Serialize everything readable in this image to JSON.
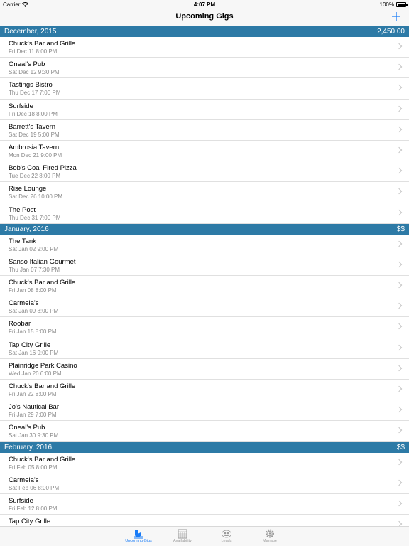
{
  "status": {
    "carrier": "Carrier",
    "time": "4:07 PM",
    "battery": "100%"
  },
  "nav": {
    "title": "Upcoming Gigs",
    "add_icon": "plus-icon",
    "accent": "#1a7cf7"
  },
  "section_color": "#2d7aa6",
  "sections": [
    {
      "label": "December, 2015",
      "total": "2,450.00",
      "gigs": [
        {
          "venue": "Chuck's Bar and Grille",
          "date": "Fri Dec 11 8:00 PM"
        },
        {
          "venue": "Oneal's Pub",
          "date": "Sat Dec 12 9:30 PM"
        },
        {
          "venue": "Tastings Bistro",
          "date": "Thu Dec 17 7:00 PM"
        },
        {
          "venue": "Surfside",
          "date": "Fri Dec 18 8:00 PM"
        },
        {
          "venue": "Barrett's Tavern",
          "date": "Sat Dec 19 5:00 PM"
        },
        {
          "venue": "Ambrosia Tavern",
          "date": "Mon Dec 21 9:00 PM"
        },
        {
          "venue": "Bob's Coal Fired Pizza",
          "date": "Tue Dec 22 8:00 PM"
        },
        {
          "venue": "Rise Lounge",
          "date": "Sat Dec 26 10:00 PM"
        },
        {
          "venue": "The Post",
          "date": "Thu Dec 31 7:00 PM"
        }
      ]
    },
    {
      "label": "January, 2016",
      "total": "$$",
      "gigs": [
        {
          "venue": "The Tank",
          "date": "Sat Jan 02 9:00 PM"
        },
        {
          "venue": "Sanso Italian Gourmet",
          "date": "Thu Jan 07 7:30 PM"
        },
        {
          "venue": "Chuck's Bar and Grille",
          "date": "Fri Jan 08 8:00 PM"
        },
        {
          "venue": "Carmela's",
          "date": "Sat Jan 09 8:00 PM"
        },
        {
          "venue": "Roobar",
          "date": "Fri Jan 15 8:00 PM"
        },
        {
          "venue": "Tap City Grille",
          "date": "Sat Jan 16 9:00 PM"
        },
        {
          "venue": "Plainridge Park Casino",
          "date": "Wed Jan 20 6:00 PM"
        },
        {
          "venue": "Chuck's Bar and Grille",
          "date": "Fri Jan 22 8:00 PM"
        },
        {
          "venue": "Jo's Nautical Bar",
          "date": "Fri Jan 29 7:00 PM"
        },
        {
          "venue": "Oneal's Pub",
          "date": "Sat Jan 30 9:30 PM"
        }
      ]
    },
    {
      "label": "February, 2016",
      "total": "$$",
      "gigs": [
        {
          "venue": "Chuck's Bar and Grille",
          "date": "Fri Feb 05 8:00 PM"
        },
        {
          "venue": "Carmela's",
          "date": "Sat Feb 06 8:00 PM"
        },
        {
          "venue": "Surfside",
          "date": "Fri Feb 12 8:00 PM"
        },
        {
          "venue": "Tap City Grille",
          "date": ""
        }
      ]
    }
  ],
  "tabs": [
    {
      "label": "Upcoming Gigs",
      "icon": "guitar-case-icon",
      "active": true
    },
    {
      "label": "Availability",
      "icon": "calendar-icon",
      "active": false
    },
    {
      "label": "Leads",
      "icon": "crowd-icon",
      "active": false
    },
    {
      "label": "Manage",
      "icon": "gear-icon",
      "active": false
    }
  ]
}
